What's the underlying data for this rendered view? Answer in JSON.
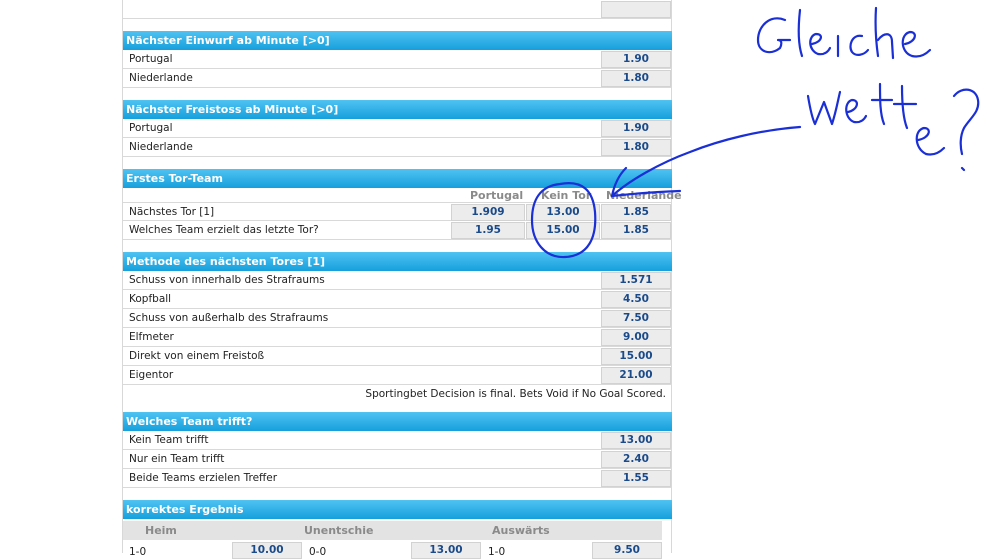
{
  "sections": {
    "einwurf": {
      "title": "Nächster Einwurf ab Minute [>0]",
      "rows": [
        {
          "label": "Portugal",
          "odds": "1.90"
        },
        {
          "label": "Niederlande",
          "odds": "1.80"
        }
      ]
    },
    "freistoss": {
      "title": "Nächster Freistoss ab Minute [>0]",
      "rows": [
        {
          "label": "Portugal",
          "odds": "1.90"
        },
        {
          "label": "Niederlande",
          "odds": "1.80"
        }
      ]
    },
    "erstes_tor": {
      "title": "Erstes Tor-Team",
      "columns": [
        "Portugal",
        "Kein Tor",
        "Niederlande"
      ],
      "rows": [
        {
          "label": "Nächstes Tor [1]",
          "odds": [
            "1.909",
            "13.00",
            "1.85"
          ]
        },
        {
          "label": "Welches Team erzielt das letzte Tor?",
          "odds": [
            "1.95",
            "15.00",
            "1.85"
          ]
        }
      ]
    },
    "methode": {
      "title": "Methode des nächsten Tores [1]",
      "rows": [
        {
          "label": "Schuss von innerhalb des Strafraums",
          "odds": "1.571"
        },
        {
          "label": "Kopfball",
          "odds": "4.50"
        },
        {
          "label": "Schuss von außerhalb des Strafraums",
          "odds": "7.50"
        },
        {
          "label": "Elfmeter",
          "odds": "9.00"
        },
        {
          "label": "Direkt von einem Freistoß",
          "odds": "15.00"
        },
        {
          "label": "Eigentor",
          "odds": "21.00"
        }
      ],
      "note": "Sportingbet Decision is final. Bets Void if No Goal Scored."
    },
    "welches_team": {
      "title": "Welches Team trifft?",
      "rows": [
        {
          "label": "Kein Team trifft",
          "odds": "13.00"
        },
        {
          "label": "Nur ein Team trifft",
          "odds": "2.40"
        },
        {
          "label": "Beide Teams erzielen Treffer",
          "odds": "1.55"
        }
      ]
    },
    "korrekt": {
      "title": "korrektes Ergebnis",
      "columns": [
        "Heim",
        "Unentschieden",
        "Auswärts"
      ],
      "first_row": [
        {
          "label": "1-0",
          "odds": "10.00"
        },
        {
          "label": "0-0",
          "odds": "13.00"
        },
        {
          "label": "1-0",
          "odds": "9.50"
        }
      ]
    }
  },
  "annotation": {
    "handwritten": "Gleiche Wette?",
    "ink_color": "#1a2fd6"
  }
}
